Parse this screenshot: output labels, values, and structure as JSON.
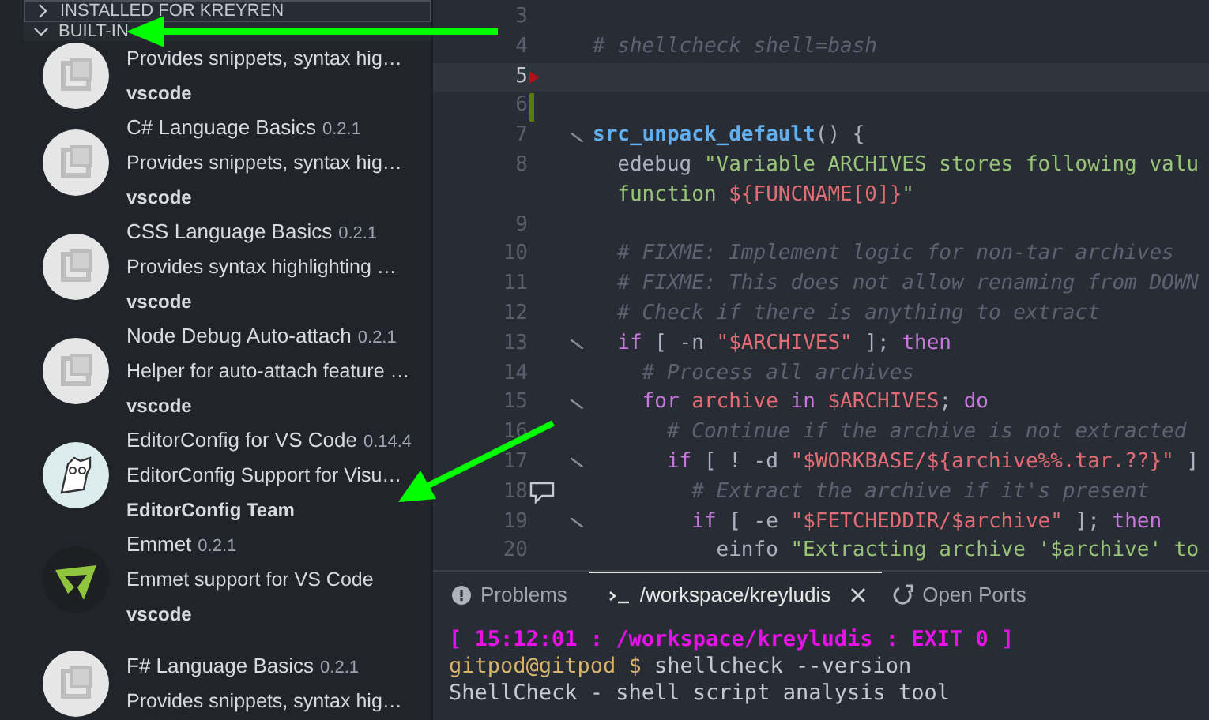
{
  "sidebar": {
    "sections": [
      {
        "title": "INSTALLED FOR KREYREN",
        "expanded": false,
        "focused": true
      },
      {
        "title": "BUILT-IN",
        "expanded": true
      }
    ],
    "extensions": [
      {
        "description": "Provides snippets, syntax hig…",
        "publisher": "vscode",
        "kind": "generic"
      },
      {
        "name": "C# Language Basics",
        "version": "0.2.1",
        "description": "Provides snippets, syntax hig…",
        "publisher": "vscode",
        "kind": "generic"
      },
      {
        "name": "CSS Language Basics",
        "version": "0.2.1",
        "description": "Provides syntax highlighting …",
        "publisher": "vscode",
        "kind": "generic"
      },
      {
        "name": "Node Debug Auto-attach",
        "version": "0.2.1",
        "description": "Helper for auto-attach feature …",
        "publisher": "vscode",
        "kind": "generic"
      },
      {
        "name": "EditorConfig for VS Code",
        "version": "0.14.4",
        "description": "EditorConfig Support for Visu…",
        "publisher": "EditorConfig Team",
        "kind": "editorconfig"
      },
      {
        "name": "Emmet",
        "version": "0.2.1",
        "description": "Emmet support for VS Code",
        "publisher": "vscode",
        "kind": "emmet"
      },
      {
        "name": "F# Language Basics",
        "version": "0.2.1",
        "description": "Provides snippets, syntax hig…",
        "kind": "generic"
      }
    ]
  },
  "editor": {
    "lines": [
      {
        "number": "3"
      },
      {
        "number": "4",
        "tokens": [
          {
            "t": "# shellcheck shell=bash",
            "kind": "comment"
          }
        ]
      },
      {
        "number": "5",
        "current": true,
        "error_marker": true
      },
      {
        "number": "6",
        "changed": true
      },
      {
        "number": "7",
        "foldable": true,
        "tokens": [
          {
            "t": "src_unpack_default",
            "kind": "function"
          },
          {
            "t": "() {",
            "kind": "plain"
          }
        ]
      },
      {
        "number": "8",
        "tokens": [
          {
            "t": "  edebug ",
            "kind": "plain"
          },
          {
            "t": "\"Variable ARCHIVES stores following valu",
            "kind": "string"
          }
        ],
        "wrap": [
          {
            "t": "  function ",
            "kind": "string"
          },
          {
            "t": "${FUNCNAME[0]}",
            "kind": "variable"
          },
          {
            "t": "\"",
            "kind": "string"
          }
        ]
      },
      {
        "number": "9"
      },
      {
        "number": "10",
        "tokens": [
          {
            "t": "  # FIXME: Implement logic for non-tar archives",
            "kind": "comment"
          }
        ]
      },
      {
        "number": "11",
        "tokens": [
          {
            "t": "  # FIXME: This does not allow renaming from DOWN",
            "kind": "comment"
          }
        ]
      },
      {
        "number": "12",
        "tokens": [
          {
            "t": "  # Check if there is anything to extract",
            "kind": "comment"
          }
        ]
      },
      {
        "number": "13",
        "foldable": true,
        "tokens": [
          {
            "t": "  if",
            "kind": "keyword"
          },
          {
            "t": " [ -n ",
            "kind": "plain"
          },
          {
            "t": "\"$ARCHIVES\"",
            "kind": "variable"
          },
          {
            "t": " ]; ",
            "kind": "plain"
          },
          {
            "t": "then",
            "kind": "keyword"
          }
        ]
      },
      {
        "number": "14",
        "tokens": [
          {
            "t": "    # Process all archives",
            "kind": "comment"
          }
        ]
      },
      {
        "number": "15",
        "foldable": true,
        "tokens": [
          {
            "t": "    for",
            "kind": "keyword"
          },
          {
            "t": " archive",
            "kind": "variable"
          },
          {
            "t": " in",
            "kind": "keyword"
          },
          {
            "t": " $ARCHIVES",
            "kind": "variable"
          },
          {
            "t": "; ",
            "kind": "plain"
          },
          {
            "t": "do",
            "kind": "keyword"
          }
        ]
      },
      {
        "number": "16",
        "tokens": [
          {
            "t": "      # Continue if the archive is not extracted",
            "kind": "comment"
          }
        ]
      },
      {
        "number": "17",
        "foldable": true,
        "tokens": [
          {
            "t": "      if",
            "kind": "keyword"
          },
          {
            "t": " [ ! -d ",
            "kind": "plain"
          },
          {
            "t": "\"$WORKBASE/${archive%%.tar.??}\"",
            "kind": "variable"
          },
          {
            "t": " ]",
            "kind": "plain"
          }
        ]
      },
      {
        "number": "18",
        "comment_icon": true,
        "tokens": [
          {
            "t": "        # Extract the archive if it's present",
            "kind": "comment"
          }
        ]
      },
      {
        "number": "19",
        "foldable": true,
        "tokens": [
          {
            "t": "        if",
            "kind": "keyword"
          },
          {
            "t": " [ -e ",
            "kind": "plain"
          },
          {
            "t": "\"$FETCHEDDIR/$archive\"",
            "kind": "variable"
          },
          {
            "t": " ]; ",
            "kind": "plain"
          },
          {
            "t": "then",
            "kind": "keyword"
          }
        ]
      },
      {
        "number": "20",
        "tokens": [
          {
            "t": "          einfo ",
            "kind": "plain"
          },
          {
            "t": "\"Extracting archive '$archive' to",
            "kind": "string"
          }
        ]
      }
    ]
  },
  "panel": {
    "tabs": [
      {
        "label": "Problems",
        "kind": "info",
        "selected": false
      },
      {
        "label": "/workspace/kreyludis",
        "kind": "terminal",
        "selected": true,
        "closable": true
      },
      {
        "label": "Open Ports",
        "kind": "ports",
        "selected": false
      }
    ],
    "terminal": [
      {
        "kind": "status",
        "text": "[ 15:12:01 : /workspace/kreyludis : EXIT 0 ]"
      },
      {
        "kind": "prompt",
        "prompt": "gitpod@gitpod $",
        "text": " shellcheck --version"
      },
      {
        "kind": "output",
        "text": "ShellCheck - shell script analysis tool"
      }
    ]
  }
}
